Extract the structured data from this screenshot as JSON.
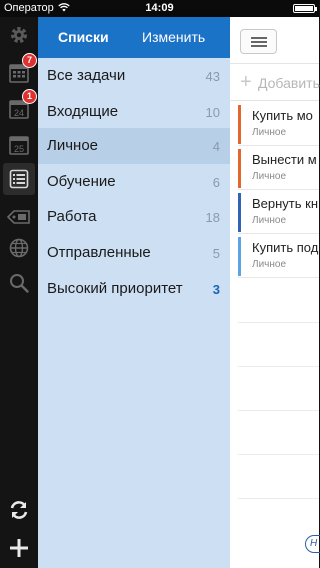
{
  "status_bar": {
    "carrier": "Оператор",
    "time": "14:09"
  },
  "rail": {
    "items": [
      {
        "name": "settings-icon"
      },
      {
        "name": "calendar-grid-icon",
        "badge": "7"
      },
      {
        "name": "calendar-day-icon",
        "badge": "1"
      },
      {
        "name": "calendar-25-icon",
        "label": "25"
      },
      {
        "name": "lists-icon"
      },
      {
        "name": "tags-icon"
      },
      {
        "name": "globe-icon"
      },
      {
        "name": "search-icon"
      },
      {
        "name": "sync-icon"
      },
      {
        "name": "add-icon"
      }
    ]
  },
  "lists_panel": {
    "title": "Списки",
    "edit_label": "Изменить",
    "items": [
      {
        "name": "Все задачи",
        "count": "43"
      },
      {
        "name": "Входящие",
        "count": "10"
      },
      {
        "name": "Личное",
        "count": "4"
      },
      {
        "name": "Обучение",
        "count": "6"
      },
      {
        "name": "Работа",
        "count": "18"
      },
      {
        "name": "Отправленные",
        "count": "5"
      },
      {
        "name": "Высокий приоритет",
        "count": "3"
      }
    ]
  },
  "tasks_panel": {
    "add_placeholder": "Добавить",
    "tasks": [
      {
        "title": "Купить мо",
        "list": "Личное",
        "color": "#e2662e"
      },
      {
        "title": "Вынести м",
        "list": "Личное",
        "color": "#e2662e"
      },
      {
        "title": "Вернуть кн",
        "list": "Личное",
        "color": "#2d64b5"
      },
      {
        "title": "Купить под",
        "list": "Личное",
        "color": "#5ea2e6"
      }
    ],
    "bottom_pill": "H"
  },
  "colors": {
    "accent": "#1b73c8",
    "panel": "#cddff2",
    "selected": "#b8cfe8"
  }
}
